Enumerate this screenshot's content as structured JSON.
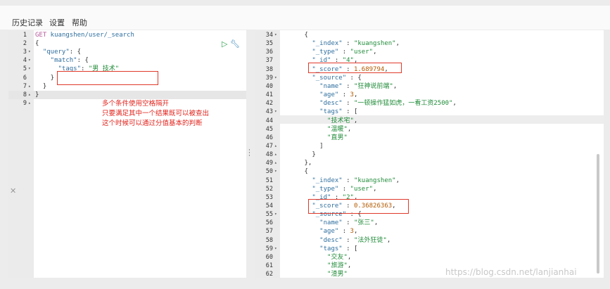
{
  "menu": {
    "history": "历史记录",
    "settings": "设置",
    "help": "帮助"
  },
  "request": {
    "method": "GET",
    "path": "kuangshen/user/_search",
    "lines": [
      {
        "n": "1",
        "fold": "",
        "parts": [
          [
            "GET",
            "m"
          ],
          [
            " kuangshen/user/_search",
            "k"
          ]
        ]
      },
      {
        "n": "2",
        "fold": "",
        "parts": [
          [
            "{",
            "p"
          ]
        ]
      },
      {
        "n": "3",
        "fold": "▾",
        "parts": [
          [
            "  \"query\"",
            "k"
          ],
          [
            ": {",
            "p"
          ]
        ]
      },
      {
        "n": "4",
        "fold": "▾",
        "parts": [
          [
            "    \"match\"",
            "k"
          ],
          [
            ": {",
            "p"
          ]
        ]
      },
      {
        "n": "5",
        "fold": "▾",
        "parts": [
          [
            "      \"tags\"",
            "k"
          ],
          [
            ": ",
            "p"
          ],
          [
            "\"男 技术\"",
            "s"
          ]
        ]
      },
      {
        "n": "6",
        "fold": "",
        "parts": [
          [
            "    }",
            "p"
          ]
        ]
      },
      {
        "n": "7",
        "fold": "▴",
        "parts": [
          [
            "  }",
            "p"
          ]
        ]
      },
      {
        "n": "8",
        "fold": "▴",
        "parts": [
          [
            "}",
            "p"
          ]
        ]
      },
      {
        "n": "9",
        "fold": "▴",
        "parts": [
          [
            "",
            "p"
          ]
        ]
      }
    ]
  },
  "annotation": [
    "多个条件使用空格隔开",
    "只要满足其中一个结果既可以被查出",
    "这个时候可以通过分值基本的判断"
  ],
  "response": {
    "lines": [
      {
        "n": "34",
        "fold": "▾",
        "parts": [
          [
            "      {",
            "p"
          ]
        ]
      },
      {
        "n": "35",
        "fold": "",
        "parts": [
          [
            "        \"_index\"",
            "k"
          ],
          [
            " : ",
            "p"
          ],
          [
            "\"kuangshen\"",
            "s"
          ],
          [
            ",",
            "p"
          ]
        ]
      },
      {
        "n": "36",
        "fold": "",
        "parts": [
          [
            "        \"_type\"",
            "k"
          ],
          [
            " : ",
            "p"
          ],
          [
            "\"user\"",
            "s"
          ],
          [
            ",",
            "p"
          ]
        ]
      },
      {
        "n": "37",
        "fold": "",
        "parts": [
          [
            "        \"_id\"",
            "k"
          ],
          [
            " : ",
            "p"
          ],
          [
            "\"4\"",
            "s"
          ],
          [
            ",",
            "p"
          ]
        ]
      },
      {
        "n": "38",
        "fold": "",
        "parts": [
          [
            "        \"_score\"",
            "k"
          ],
          [
            " : ",
            "p"
          ],
          [
            "1.689794",
            "r"
          ],
          [
            ",",
            "p"
          ]
        ]
      },
      {
        "n": "39",
        "fold": "▾",
        "parts": [
          [
            "        \"_source\"",
            "k"
          ],
          [
            " : {",
            "p"
          ]
        ]
      },
      {
        "n": "40",
        "fold": "",
        "parts": [
          [
            "          \"name\"",
            "k"
          ],
          [
            " : ",
            "p"
          ],
          [
            "\"狂神说前端\"",
            "s"
          ],
          [
            ",",
            "p"
          ]
        ]
      },
      {
        "n": "41",
        "fold": "",
        "parts": [
          [
            "          \"age\"",
            "k"
          ],
          [
            " : ",
            "p"
          ],
          [
            "3",
            "r"
          ],
          [
            ",",
            "p"
          ]
        ]
      },
      {
        "n": "42",
        "fold": "",
        "parts": [
          [
            "          \"desc\"",
            "k"
          ],
          [
            " : ",
            "p"
          ],
          [
            "\"一顿操作猛如虎，一看工资2500\"",
            "s"
          ],
          [
            ",",
            "p"
          ]
        ]
      },
      {
        "n": "43",
        "fold": "▾",
        "parts": [
          [
            "          \"tags\"",
            "k"
          ],
          [
            " : [",
            "p"
          ]
        ]
      },
      {
        "n": "44",
        "fold": "",
        "parts": [
          [
            "            \"技术宅\"",
            "s"
          ],
          [
            ",",
            "p"
          ]
        ]
      },
      {
        "n": "45",
        "fold": "",
        "parts": [
          [
            "            \"温暖\"",
            "s"
          ],
          [
            ",",
            "p"
          ]
        ]
      },
      {
        "n": "46",
        "fold": "",
        "parts": [
          [
            "            \"直男\"",
            "s"
          ]
        ]
      },
      {
        "n": "47",
        "fold": "▴",
        "parts": [
          [
            "          ]",
            "p"
          ]
        ]
      },
      {
        "n": "48",
        "fold": "▴",
        "parts": [
          [
            "        }",
            "p"
          ]
        ]
      },
      {
        "n": "49",
        "fold": "▴",
        "parts": [
          [
            "      },",
            "p"
          ]
        ]
      },
      {
        "n": "50",
        "fold": "▾",
        "parts": [
          [
            "      {",
            "p"
          ]
        ]
      },
      {
        "n": "51",
        "fold": "",
        "parts": [
          [
            "        \"_index\"",
            "k"
          ],
          [
            " : ",
            "p"
          ],
          [
            "\"kuangshen\"",
            "s"
          ],
          [
            ",",
            "p"
          ]
        ]
      },
      {
        "n": "52",
        "fold": "",
        "parts": [
          [
            "        \"_type\"",
            "k"
          ],
          [
            " : ",
            "p"
          ],
          [
            "\"user\"",
            "s"
          ],
          [
            ",",
            "p"
          ]
        ]
      },
      {
        "n": "53",
        "fold": "",
        "parts": [
          [
            "        \"_id\"",
            "k"
          ],
          [
            " : ",
            "p"
          ],
          [
            "\"2\"",
            "s"
          ],
          [
            ",",
            "p"
          ]
        ]
      },
      {
        "n": "54",
        "fold": "",
        "parts": [
          [
            "        \"_score\"",
            "k"
          ],
          [
            " : ",
            "p"
          ],
          [
            "0.36826363",
            "r"
          ],
          [
            ",",
            "p"
          ]
        ]
      },
      {
        "n": "55",
        "fold": "▾",
        "parts": [
          [
            "        \"_source\"",
            "k"
          ],
          [
            " : {",
            "p"
          ]
        ]
      },
      {
        "n": "56",
        "fold": "",
        "parts": [
          [
            "          \"name\"",
            "k"
          ],
          [
            " : ",
            "p"
          ],
          [
            "\"张三\"",
            "s"
          ],
          [
            ",",
            "p"
          ]
        ]
      },
      {
        "n": "57",
        "fold": "",
        "parts": [
          [
            "          \"age\"",
            "k"
          ],
          [
            " : ",
            "p"
          ],
          [
            "3",
            "r"
          ],
          [
            ",",
            "p"
          ]
        ]
      },
      {
        "n": "58",
        "fold": "",
        "parts": [
          [
            "          \"desc\"",
            "k"
          ],
          [
            " : ",
            "p"
          ],
          [
            "\"法外狂徒\"",
            "s"
          ],
          [
            ",",
            "p"
          ]
        ]
      },
      {
        "n": "59",
        "fold": "▾",
        "parts": [
          [
            "          \"tags\"",
            "k"
          ],
          [
            " : [",
            "p"
          ]
        ]
      },
      {
        "n": "60",
        "fold": "",
        "parts": [
          [
            "            \"交友\"",
            "s"
          ],
          [
            ",",
            "p"
          ]
        ]
      },
      {
        "n": "61",
        "fold": "",
        "parts": [
          [
            "            \"旅游\"",
            "s"
          ],
          [
            ",",
            "p"
          ]
        ]
      },
      {
        "n": "62",
        "fold": "",
        "parts": [
          [
            "            \"渣男\"",
            "s"
          ]
        ]
      }
    ]
  },
  "watermark": "https://blog.csdn.net/lanjianhai",
  "icons": {
    "run": "play-icon",
    "settings": "wrench-icon",
    "close": "close-icon"
  },
  "colors": {
    "annotation": "#e1231c",
    "key": "#2f6f9f",
    "string": "#218c3a",
    "number": "#b35a00"
  }
}
